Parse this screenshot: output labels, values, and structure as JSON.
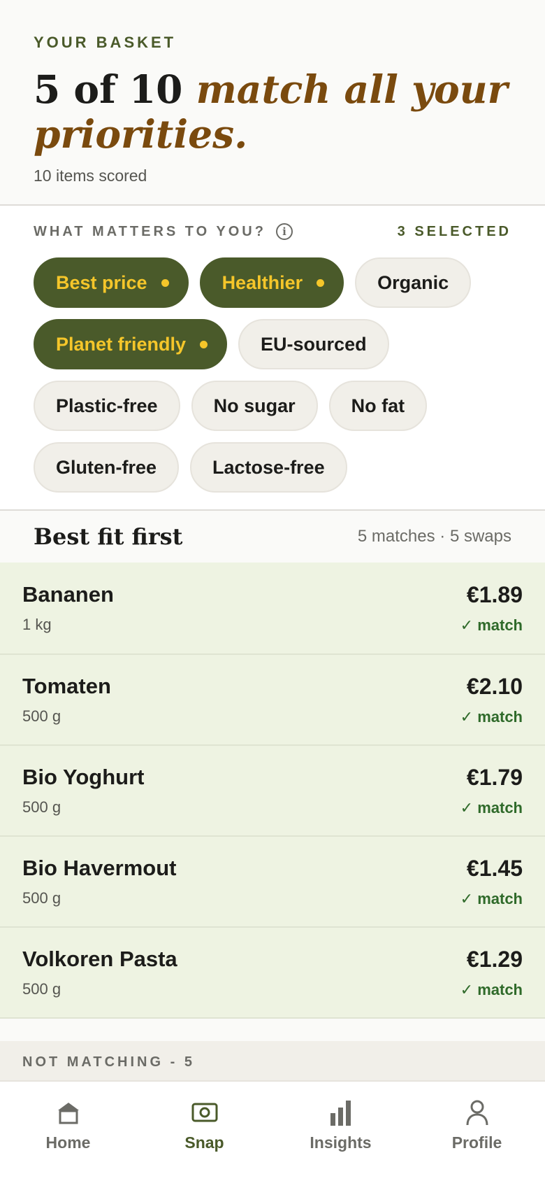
{
  "header": {
    "eyebrow": "YOUR BASKET",
    "headline_count": "5 of 10",
    "headline_emph": "match all your priorities.",
    "subline": "10 items scored"
  },
  "preferences": {
    "title": "WHAT MATTERS TO YOU?",
    "selected_label": "3 SELECTED",
    "chips": [
      {
        "label": "Best price",
        "active": true
      },
      {
        "label": "Healthier",
        "active": true
      },
      {
        "label": "Organic",
        "active": false
      },
      {
        "label": "Planet friendly",
        "active": true
      },
      {
        "label": "EU-sourced",
        "active": false
      },
      {
        "label": "Plastic-free",
        "active": false
      },
      {
        "label": "No sugar",
        "active": false
      },
      {
        "label": "No fat",
        "active": false
      },
      {
        "label": "Gluten-free",
        "active": false
      },
      {
        "label": "Lactose-free",
        "active": false
      }
    ]
  },
  "results": {
    "title": "Best fit first",
    "meta": "5 matches · 5 swaps",
    "items": [
      {
        "name": "Bananen",
        "size": "1 kg",
        "price": "€1.89",
        "status": "✓ match"
      },
      {
        "name": "Tomaten",
        "size": "500 g",
        "price": "€2.10",
        "status": "✓ match"
      },
      {
        "name": "Bio Yoghurt",
        "size": "500 g",
        "price": "€1.79",
        "status": "✓ match"
      },
      {
        "name": "Bio Havermout",
        "size": "500 g",
        "price": "€1.45",
        "status": "✓ match"
      },
      {
        "name": "Volkoren Pasta",
        "size": "500 g",
        "price": "€1.29",
        "status": "✓ match"
      }
    ],
    "not_matching_label": "NOT MATCHING - 5"
  },
  "tabbar": {
    "tabs": [
      {
        "label": "Home",
        "icon": "home-icon",
        "active": false
      },
      {
        "label": "Snap",
        "icon": "camera-icon",
        "active": true
      },
      {
        "label": "Insights",
        "icon": "bar-chart-icon",
        "active": false
      },
      {
        "label": "Profile",
        "icon": "person-icon",
        "active": false
      }
    ]
  },
  "colors": {
    "accent_green": "#4a5a2a",
    "chip_highlight": "#f5c62a",
    "headline_brown": "#7a4a0e",
    "match_bg": "#eef3e2",
    "match_text": "#2f6a2a"
  }
}
